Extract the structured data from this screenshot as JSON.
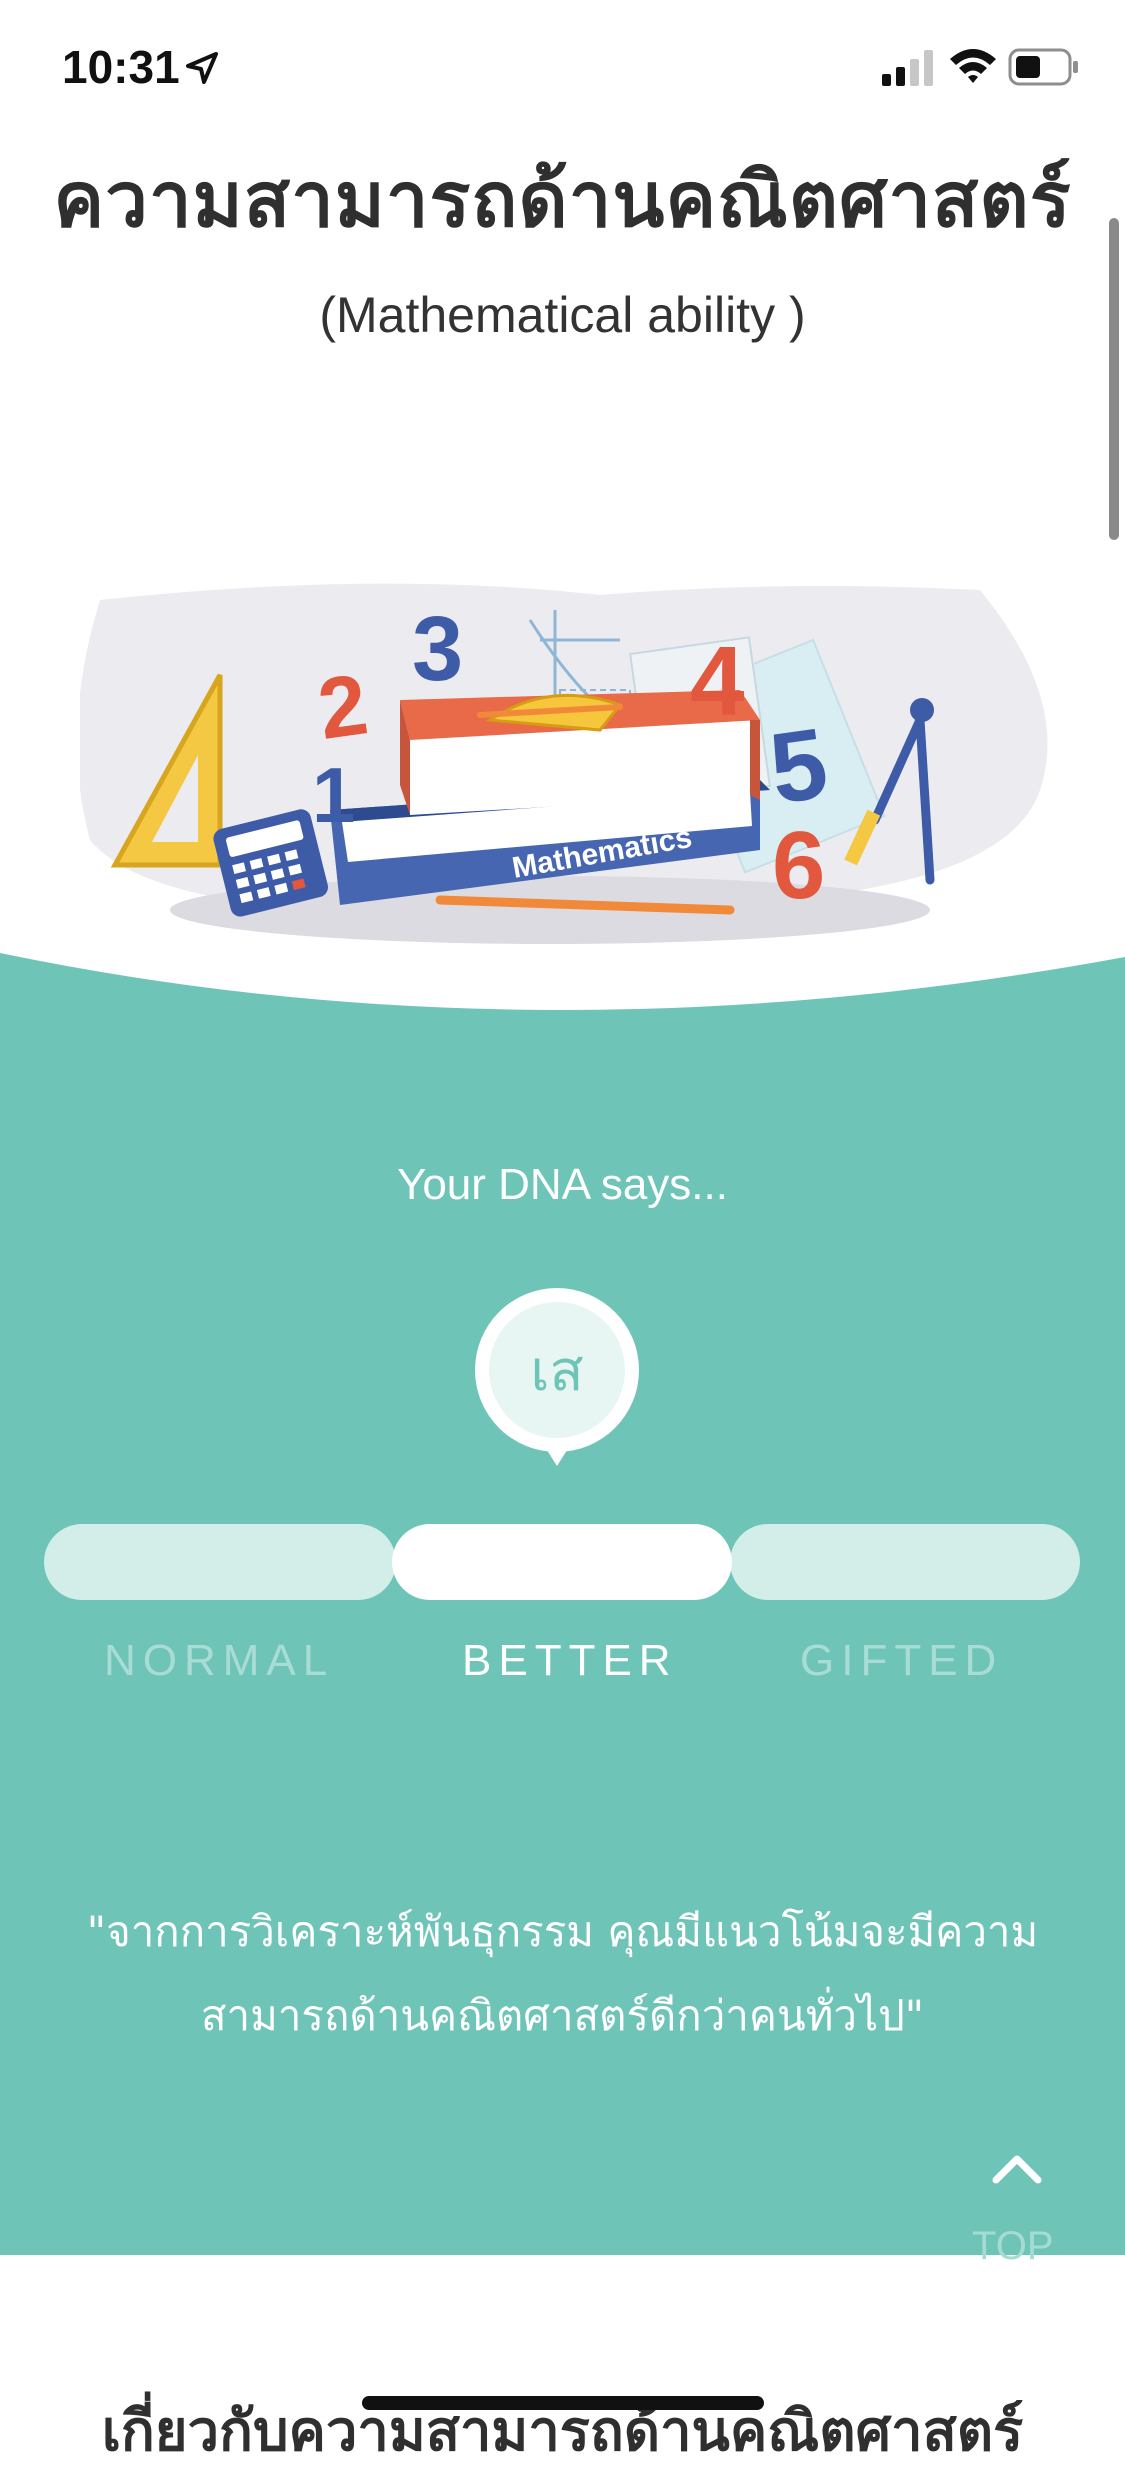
{
  "status_bar": {
    "time": "10:31",
    "icons": [
      "location-arrow-icon",
      "cellular-signal-icon",
      "wifi-icon",
      "battery-icon"
    ]
  },
  "header": {
    "title": "ความสามารถด้านคณิตศาสตร์",
    "subtitle": "(Mathematical ability )"
  },
  "illustration": {
    "book_label": "Mathematics",
    "numbers": [
      "1",
      "2",
      "3",
      "4",
      "5",
      "6"
    ]
  },
  "result": {
    "dna_label": "Your DNA says...",
    "marker_text": "เส",
    "levels": [
      "NORMAL",
      "BETTER",
      "GIFTED"
    ],
    "selected_level": "BETTER",
    "quote": "\"จากการวิเคราะห์พันธุกรรม คุณมีแนวโน้มจะมีความสามารถด้านคณิตศาสตร์ดีกว่าคนทั่วไป\""
  },
  "top_button": {
    "label": "TOP",
    "icon": "chevron-up-icon"
  },
  "next_section": {
    "heading": "เกี่ยวกับความสามารถด้านคณิตศาสตร์"
  },
  "colors": {
    "teal": "#6fc4b8",
    "light_teal": "#d3ede9",
    "white": "#ffffff",
    "text_dark": "#2f2f2f"
  }
}
